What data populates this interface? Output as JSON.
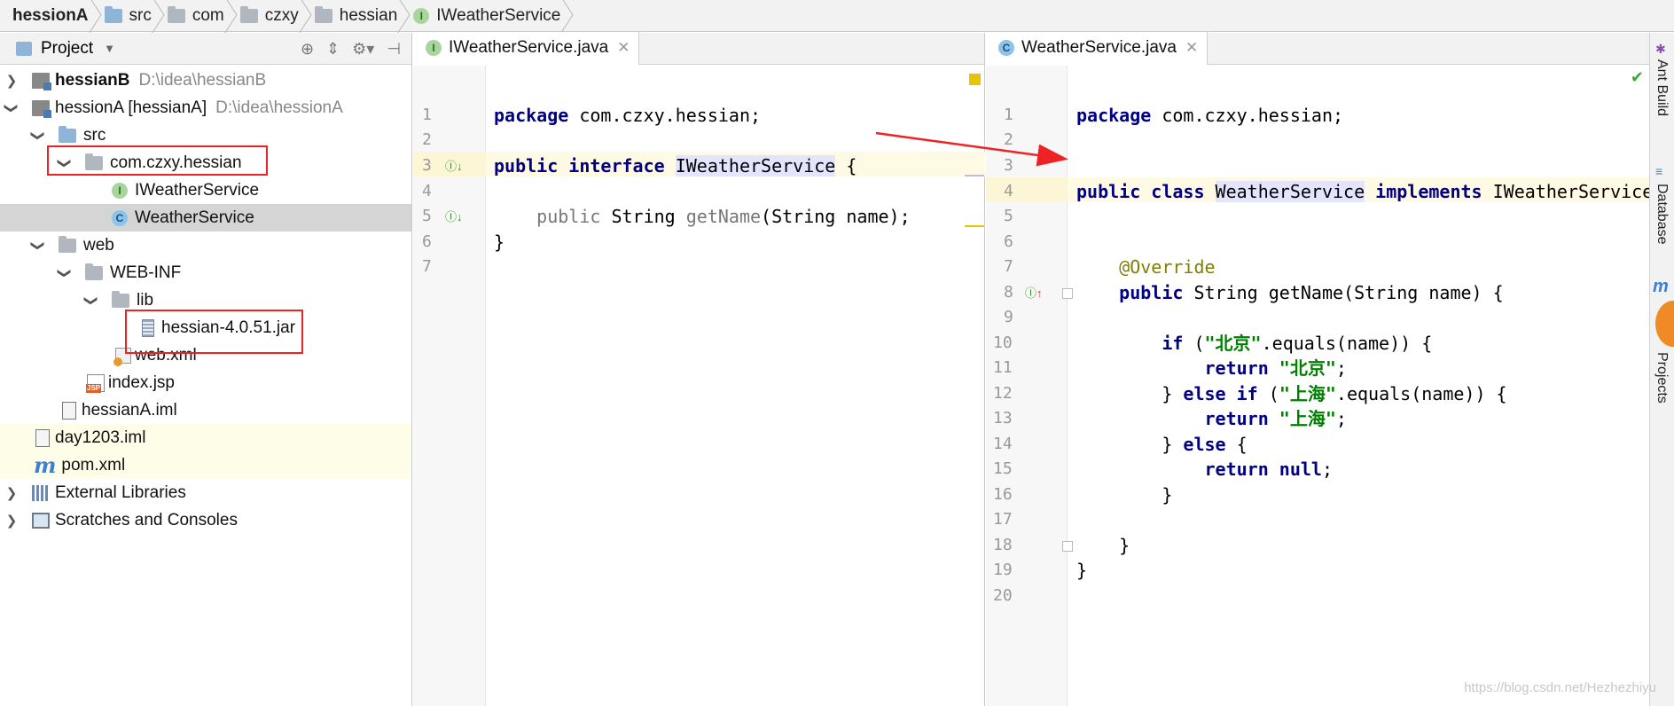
{
  "breadcrumb": [
    "hessionA",
    "src",
    "com",
    "czxy",
    "hessian",
    "IWeatherService"
  ],
  "project": {
    "title": "Project",
    "tree": [
      {
        "label": "hessianB",
        "path": "D:\\idea\\hessianB"
      },
      {
        "label": "hessionA [hessianA]",
        "path": "D:\\idea\\hessionA"
      },
      {
        "label": "src"
      },
      {
        "label": "com.czxy.hessian"
      },
      {
        "label": "IWeatherService"
      },
      {
        "label": "WeatherService"
      },
      {
        "label": "web"
      },
      {
        "label": "WEB-INF"
      },
      {
        "label": "lib"
      },
      {
        "label": "hessian-4.0.51.jar"
      },
      {
        "label": "web.xml"
      },
      {
        "label": "index.jsp"
      },
      {
        "label": "hessianA.iml"
      },
      {
        "label": "day1203.iml"
      },
      {
        "label": "pom.xml"
      },
      {
        "label": "External Libraries"
      },
      {
        "label": "Scratches and Consoles"
      }
    ]
  },
  "left_editor": {
    "tab": "IWeatherService.java",
    "line_numbers": [
      "1",
      "2",
      "3",
      "4",
      "5",
      "6",
      "7"
    ]
  },
  "right_editor": {
    "tab": "WeatherService.java",
    "line_numbers": [
      "1",
      "2",
      "3",
      "4",
      "5",
      "6",
      "7",
      "8",
      "9",
      "10",
      "11",
      "12",
      "13",
      "14",
      "15",
      "16",
      "17",
      "18",
      "19",
      "20"
    ]
  },
  "right_sidebar": {
    "tabs": [
      "Ant Build",
      "Database",
      "Projects"
    ]
  },
  "watermark": "https://blog.csdn.net/Hezhezhiyu"
}
